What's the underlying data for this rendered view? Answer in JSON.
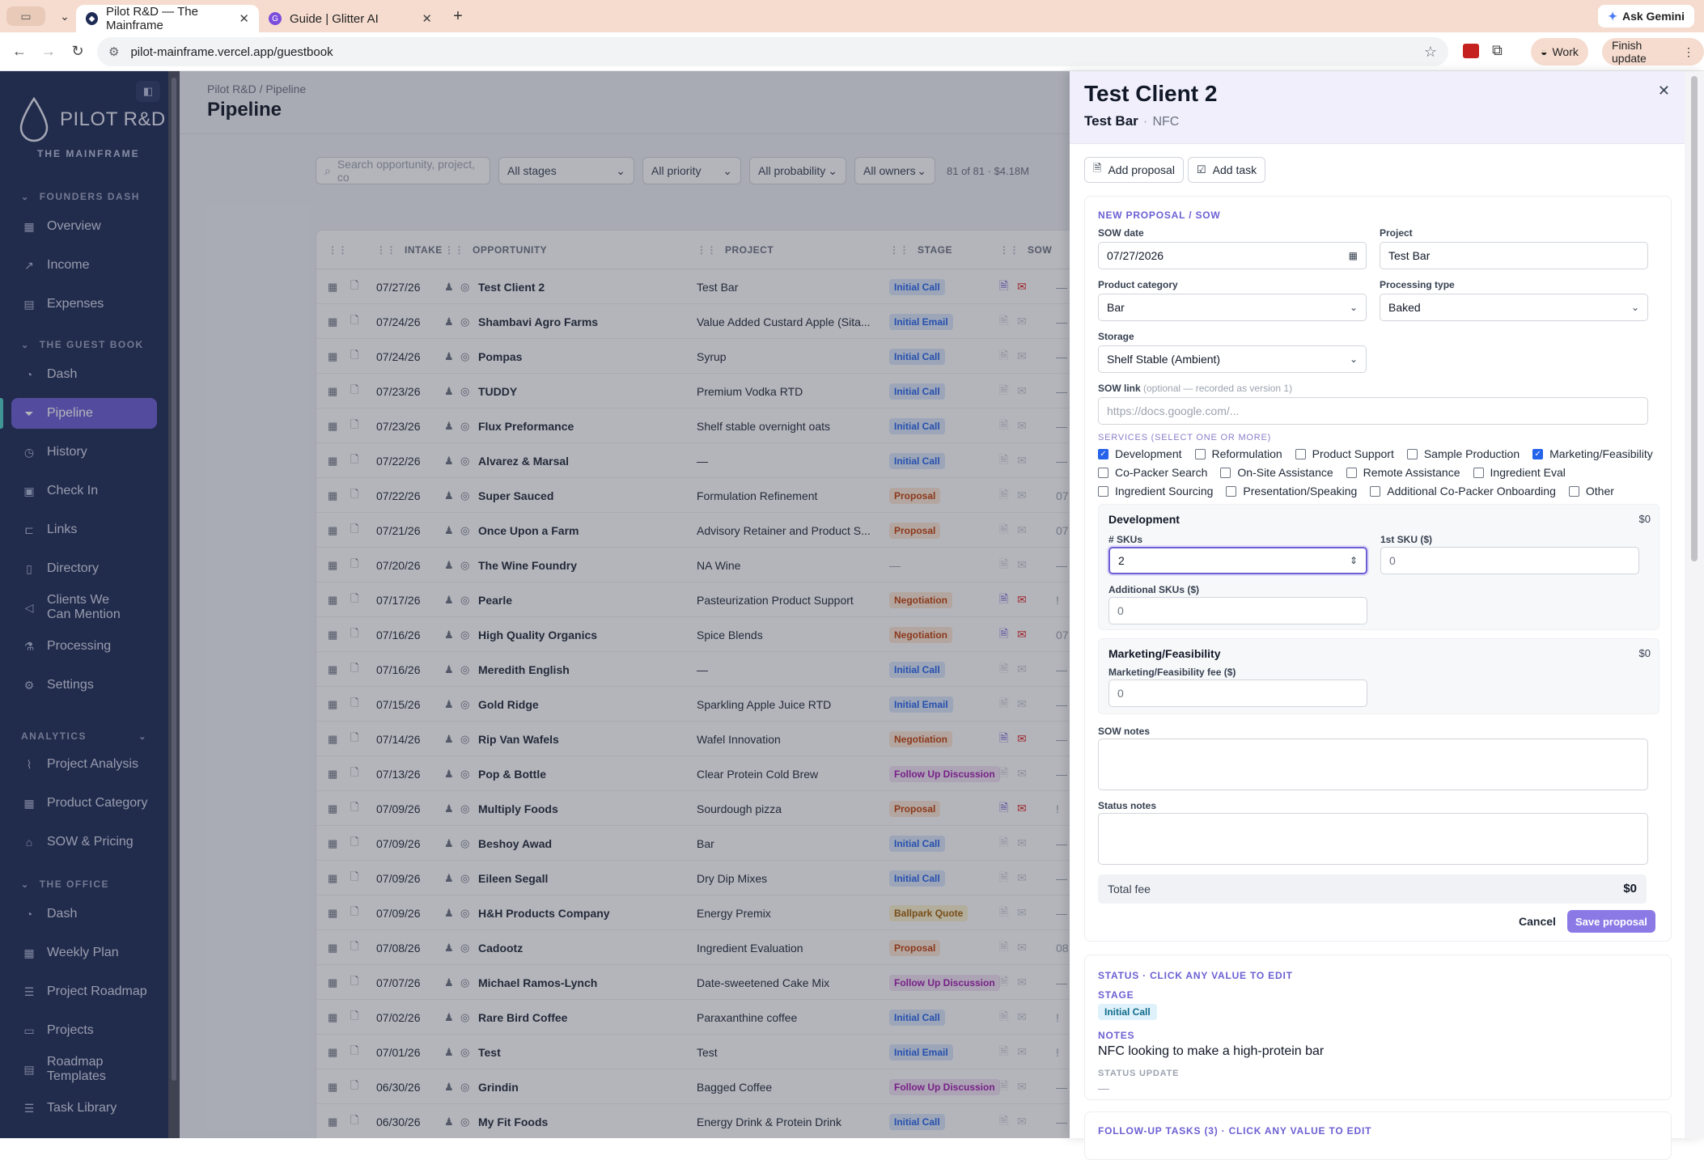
{
  "browser": {
    "tabs": [
      {
        "title": "Pilot R&D — The Mainframe",
        "active": true
      },
      {
        "title": "Guide | Glitter AI",
        "active": false
      }
    ],
    "url": "pilot-mainframe.vercel.app/guestbook",
    "ask_gemini": "Ask Gemini",
    "profile": "Work",
    "finish_update": "Finish update"
  },
  "sidebar": {
    "logo": "PILOT R&D",
    "logo_sub": "THE MAINFRAME",
    "sections": [
      {
        "title": "FOUNDERS DASH",
        "items": [
          "Overview",
          "Income",
          "Expenses"
        ]
      },
      {
        "title": "THE GUEST BOOK",
        "items": [
          "Dash",
          "Pipeline",
          "History",
          "Check In",
          "Links",
          "Directory",
          "Clients We Can Mention",
          "Processing",
          "Settings"
        ]
      },
      {
        "title": "ANALYTICS",
        "items": [
          "Project Analysis",
          "Product Category",
          "SOW & Pricing"
        ]
      },
      {
        "title": "THE OFFICE",
        "items": [
          "Dash",
          "Weekly Plan",
          "Project Roadmap",
          "Projects",
          "Roadmap Templates",
          "Task Library"
        ]
      }
    ],
    "active_item": "Pipeline"
  },
  "main": {
    "breadcrumb": "Pilot R&D / Pipeline",
    "title": "Pipeline",
    "search_placeholder": "Search opportunity, project, co",
    "filters": [
      "All stages",
      "All priority",
      "All probability",
      "All owners"
    ],
    "count": "81 of 81 · $4.18M",
    "columns": [
      "INTAKE",
      "OPPORTUNITY",
      "PROJECT",
      "STAGE",
      "SOW"
    ],
    "rows": [
      {
        "date": "07/27/26",
        "name": "Test Client 2",
        "project": "Test Bar",
        "stage": "Initial Call",
        "cls": "b-call",
        "docs": true,
        "extra": "—"
      },
      {
        "date": "07/24/26",
        "name": "Shambavi Agro Farms",
        "project": "Value Added Custard Apple (Sita...",
        "stage": "Initial Email",
        "cls": "b-email",
        "docs": false,
        "extra": "—"
      },
      {
        "date": "07/24/26",
        "name": "Pompas",
        "project": "Syrup",
        "stage": "Initial Call",
        "cls": "b-call",
        "docs": false,
        "extra": "—"
      },
      {
        "date": "07/23/26",
        "name": "TUDDY",
        "project": "Premium Vodka RTD",
        "stage": "Initial Call",
        "cls": "b-call",
        "docs": false,
        "extra": "—"
      },
      {
        "date": "07/23/26",
        "name": "Flux Preformance",
        "project": "Shelf stable overnight oats",
        "stage": "Initial Call",
        "cls": "b-call",
        "docs": false,
        "extra": "—"
      },
      {
        "date": "07/22/26",
        "name": "Alvarez & Marsal",
        "project": "—",
        "stage": "Initial Call",
        "cls": "b-call",
        "docs": false,
        "extra": "—"
      },
      {
        "date": "07/22/26",
        "name": "Super Sauced",
        "project": "Formulation Refinement",
        "stage": "Proposal",
        "cls": "b-prop",
        "docs": false,
        "extra": "07"
      },
      {
        "date": "07/21/26",
        "name": "Once Upon a Farm",
        "project": "Advisory Retainer and Product S...",
        "stage": "Proposal",
        "cls": "b-prop",
        "docs": false,
        "extra": "07"
      },
      {
        "date": "07/20/26",
        "name": "The Wine Foundry",
        "project": "NA Wine",
        "stage": "—",
        "cls": "",
        "docs": false,
        "extra": "—"
      },
      {
        "date": "07/17/26",
        "name": "Pearle",
        "project": "Pasteurization Product Support",
        "stage": "Negotiation",
        "cls": "b-neg",
        "docs": true,
        "extra": "!"
      },
      {
        "date": "07/16/26",
        "name": "High Quality Organics",
        "project": "Spice Blends",
        "stage": "Negotiation",
        "cls": "b-neg",
        "docs": true,
        "extra": "07"
      },
      {
        "date": "07/16/26",
        "name": "Meredith English",
        "project": "—",
        "stage": "Initial Call",
        "cls": "b-call",
        "docs": false,
        "extra": "—"
      },
      {
        "date": "07/15/26",
        "name": "Gold Ridge",
        "project": "Sparkling Apple Juice RTD",
        "stage": "Initial Email",
        "cls": "b-email",
        "docs": false,
        "extra": "—"
      },
      {
        "date": "07/14/26",
        "name": "Rip Van Wafels",
        "project": "Wafel Innovation",
        "stage": "Negotiation",
        "cls": "b-neg",
        "docs": true,
        "extra": "—"
      },
      {
        "date": "07/13/26",
        "name": "Pop & Bottle",
        "project": "Clear Protein Cold Brew",
        "stage": "Follow Up Discussion",
        "cls": "b-follow",
        "docs": false,
        "extra": "—"
      },
      {
        "date": "07/09/26",
        "name": "Multiply Foods",
        "project": "Sourdough pizza",
        "stage": "Proposal",
        "cls": "b-prop",
        "docs": true,
        "extra": "!"
      },
      {
        "date": "07/09/26",
        "name": "Beshoy Awad",
        "project": "Bar",
        "stage": "Initial Call",
        "cls": "b-call",
        "docs": false,
        "extra": "—"
      },
      {
        "date": "07/09/26",
        "name": "Eileen Segall",
        "project": "Dry Dip Mixes",
        "stage": "Initial Call",
        "cls": "b-call",
        "docs": false,
        "extra": "—"
      },
      {
        "date": "07/09/26",
        "name": "H&H Products Company",
        "project": "Energy Premix",
        "stage": "Ballpark Quote",
        "cls": "b-ball",
        "docs": false,
        "extra": "—"
      },
      {
        "date": "07/08/26",
        "name": "Cadootz",
        "project": "Ingredient Evaluation",
        "stage": "Proposal",
        "cls": "b-prop",
        "docs": false,
        "extra": "08"
      },
      {
        "date": "07/07/26",
        "name": "Michael Ramos-Lynch",
        "project": "Date-sweetened Cake Mix",
        "stage": "Follow Up Discussion",
        "cls": "b-follow",
        "docs": false,
        "extra": "—"
      },
      {
        "date": "07/02/26",
        "name": "Rare Bird Coffee",
        "project": "Paraxanthine coffee",
        "stage": "Initial Call",
        "cls": "b-call",
        "docs": false,
        "extra": "!"
      },
      {
        "date": "07/01/26",
        "name": "Test",
        "project": "Test",
        "stage": "Initial Email",
        "cls": "b-email",
        "docs": false,
        "extra": "!"
      },
      {
        "date": "06/30/26",
        "name": "Grindin",
        "project": "Bagged Coffee",
        "stage": "Follow Up Discussion",
        "cls": "b-follow",
        "docs": false,
        "extra": "—"
      },
      {
        "date": "06/30/26",
        "name": "My Fit Foods",
        "project": "Energy Drink & Protein Drink",
        "stage": "Initial Call",
        "cls": "b-call",
        "docs": false,
        "extra": "—"
      }
    ]
  },
  "drawer": {
    "title": "Test Client 2",
    "subtitle": "Test Bar",
    "tag": "NFC",
    "add_proposal": "Add proposal",
    "add_task": "Add task",
    "form": {
      "heading": "NEW PROPOSAL / SOW",
      "sow_date_label": "SOW date",
      "sow_date": "07/27/2026",
      "project_label": "Project",
      "project": "Test Bar",
      "category_label": "Product category",
      "category": "Bar",
      "processing_label": "Processing type",
      "processing": "Baked",
      "storage_label": "Storage",
      "storage": "Shelf Stable (Ambient)",
      "sow_link_label": "SOW link",
      "sow_link_hint": "(optional — recorded as version 1)",
      "sow_link_placeholder": "https://docs.google.com/...",
      "services_label": "SERVICES (SELECT ONE OR MORE)",
      "services_row1": [
        {
          "label": "Development",
          "checked": true
        },
        {
          "label": "Reformulation",
          "checked": false
        },
        {
          "label": "Product Support",
          "checked": false
        },
        {
          "label": "Sample Production",
          "checked": false
        },
        {
          "label": "Marketing/Feasibility",
          "checked": true
        }
      ],
      "services_row2": [
        {
          "label": "Co-Packer Search",
          "checked": false
        },
        {
          "label": "On-Site Assistance",
          "checked": false
        },
        {
          "label": "Remote Assistance",
          "checked": false
        },
        {
          "label": "Ingredient Eval",
          "checked": false
        }
      ],
      "services_row3": [
        {
          "label": "Ingredient Sourcing",
          "checked": false
        },
        {
          "label": "Presentation/Speaking",
          "checked": false
        },
        {
          "label": "Additional Co-Packer Onboarding",
          "checked": false
        },
        {
          "label": "Other",
          "checked": false
        }
      ],
      "dev_title": "Development",
      "dev_amount": "$0",
      "skus_label": "# SKUs",
      "skus_value": "2",
      "first_sku_label": "1st SKU ($)",
      "first_sku_value": "0",
      "add_skus_label": "Additional SKUs ($)",
      "add_skus_value": "0",
      "mkt_title": "Marketing/Feasibility",
      "mkt_amount": "$0",
      "mkt_fee_label": "Marketing/Feasibility fee ($)",
      "mkt_fee_value": "0",
      "sow_notes_label": "SOW notes",
      "status_notes_label": "Status notes",
      "total_label": "Total fee",
      "total_value": "$0",
      "cancel": "Cancel",
      "save": "Save proposal"
    },
    "status": {
      "heading": "STATUS · CLICK ANY VALUE TO EDIT",
      "stage_label": "STAGE",
      "stage": "Initial Call",
      "notes_label": "NOTES",
      "notes": "NFC looking to make a high-protein bar",
      "update_label": "STATUS UPDATE",
      "update": "—"
    },
    "followup_heading": "FOLLOW-UP TASKS (3) · CLICK ANY VALUE TO EDIT"
  }
}
